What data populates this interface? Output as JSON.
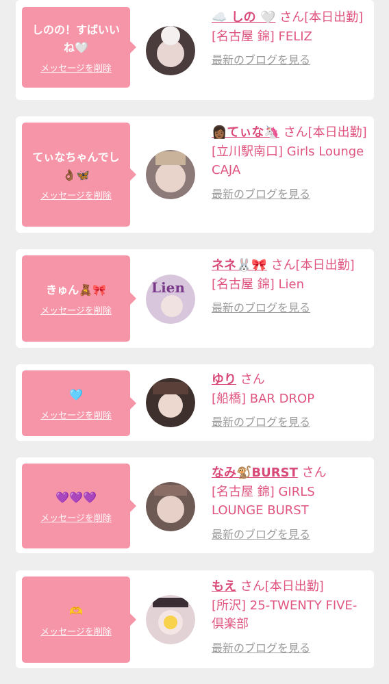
{
  "entries": [
    {
      "message": "しのの！すばいいね🤍",
      "delete_label": "メッセージを削除",
      "name": "☁️ しの 🤍",
      "honorific": "さん[本日出勤]",
      "shop": "[名古屋 錦] FELIZ",
      "blog_label": "最新のブログを見る",
      "avatar_color": "#5a4a4a"
    },
    {
      "message": "てぃなちゃんでし👌🏾🦋",
      "delete_label": "メッセージを削除",
      "name": "👩🏾てぃな🦄",
      "honorific": "さん[本日出勤]",
      "shop": "[立川駅南口] Girls Lounge CAJA",
      "blog_label": "最新のブログを見る",
      "avatar_color": "#8a7a7a"
    },
    {
      "message": "きゅん🧸🎀",
      "delete_label": "メッセージを削除",
      "name": "ネネ🐰🎀",
      "honorific": "さん[本日出勤]",
      "shop": "[名古屋 錦] Lien",
      "blog_label": "最新のブログを見る",
      "avatar_color": "#d4c0d8"
    },
    {
      "message": "🩵",
      "delete_label": "メッセージを削除",
      "name": "ゆり",
      "honorific": "さん",
      "shop": "[船橋] BAR DROP",
      "blog_label": "最新のブログを見る",
      "avatar_color": "#4a3a35"
    },
    {
      "message": "💜💜💜",
      "delete_label": "メッセージを削除",
      "name": "なみ🐒BURST",
      "honorific": "さん",
      "shop": "[名古屋 錦] GIRLS LOUNGE BURST",
      "blog_label": "最新のブログを見る",
      "avatar_color": "#7a6660"
    },
    {
      "message": "🫶",
      "delete_label": "メッセージを削除",
      "name": "もえ",
      "honorific": "さん[本日出勤]",
      "shop": "[所沢] 25-TWENTY FIVE-倶楽部",
      "blog_label": "最新のブログを見る",
      "avatar_color": "#c9b8bb"
    }
  ]
}
